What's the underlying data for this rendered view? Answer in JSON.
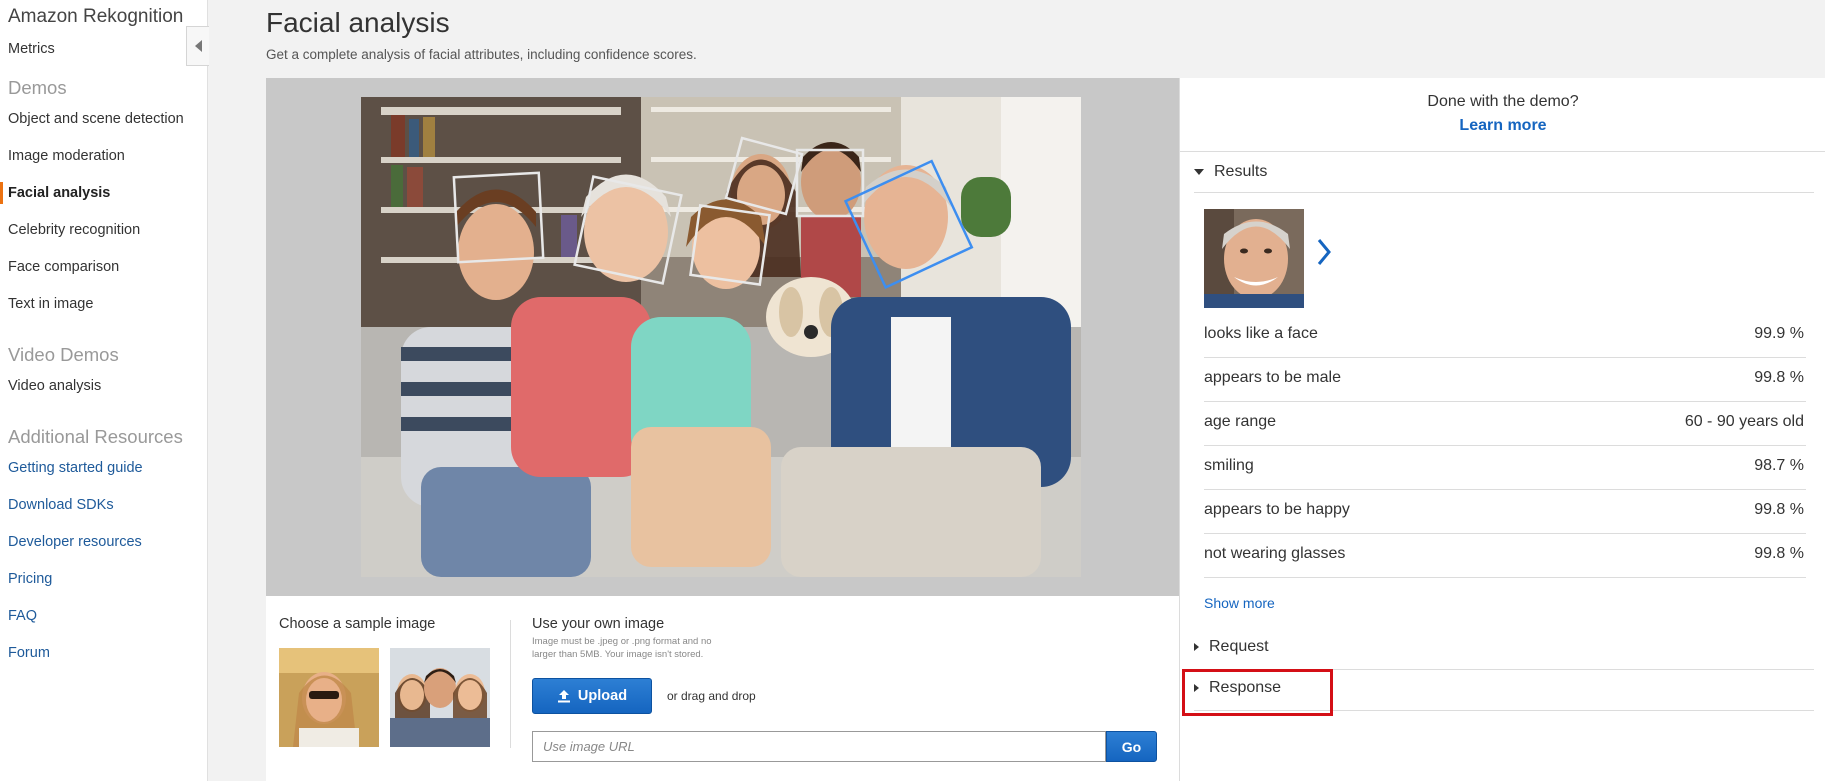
{
  "sidebar": {
    "title": "Amazon Rekognition",
    "metrics": "Metrics",
    "demos_heading": "Demos",
    "demo_items": [
      "Object and scene detection",
      "Image moderation",
      "Facial analysis",
      "Celebrity recognition",
      "Face comparison",
      "Text in image"
    ],
    "video_heading": "Video Demos",
    "video_items": [
      "Video analysis"
    ],
    "resources_heading": "Additional Resources",
    "resource_items": [
      "Getting started guide",
      "Download SDKs",
      "Developer resources",
      "Pricing",
      "FAQ",
      "Forum"
    ],
    "active_item": "Facial analysis",
    "accent_color": "#ec7211"
  },
  "header": {
    "title": "Facial analysis",
    "subtitle": "Get a complete analysis of facial attributes, including confidence scores."
  },
  "bottom": {
    "sample_label": "Choose a sample image",
    "own_label": "Use your own image",
    "note_line1": "Image must be .jpeg or .png format and no",
    "note_line2": "larger than 5MB. Your image isn't stored.",
    "upload_label": "Upload",
    "drag_text": "or drag and drop",
    "url_placeholder": "Use image URL",
    "go_label": "Go"
  },
  "right": {
    "done_text": "Done with the demo?",
    "learn_more": "Learn more",
    "results_label": "Results",
    "attributes": [
      {
        "name": "looks like a face",
        "value": "99.9 %"
      },
      {
        "name": "appears to be male",
        "value": "99.8 %"
      },
      {
        "name": "age range",
        "value": "60 - 90 years old"
      },
      {
        "name": "smiling",
        "value": "98.7 %"
      },
      {
        "name": "appears to be happy",
        "value": "99.8 %"
      },
      {
        "name": "not wearing glasses",
        "value": "99.8 %"
      }
    ],
    "show_more": "Show more",
    "request_label": "Request",
    "response_label": "Response",
    "link_color": "#1565c0"
  },
  "icons": {
    "collapse": "triangle-left-icon",
    "upload": "upload-arrow-icon",
    "next": "chevron-right-icon",
    "expanded": "triangle-down-icon",
    "collapsed": "triangle-right-icon"
  }
}
